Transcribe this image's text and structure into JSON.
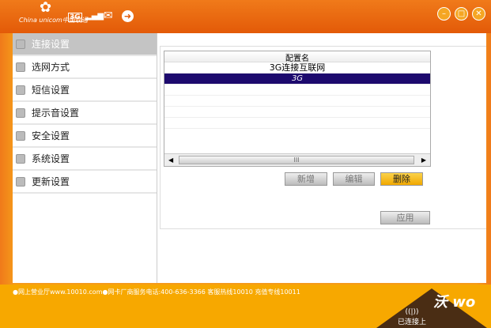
{
  "header": {
    "logo_text": "China unicom中国联通",
    "network_badge": "3G",
    "signal": "signal-bars-icon",
    "icons": [
      "mail-icon",
      "update-icon"
    ],
    "window_controls": [
      "minimize-icon",
      "restore-icon",
      "close-icon"
    ]
  },
  "sidebar": {
    "items": [
      {
        "label": "连接设置",
        "active": true
      },
      {
        "label": "选网方式"
      },
      {
        "label": "短信设置"
      },
      {
        "label": "提示音设置"
      },
      {
        "label": "安全设置"
      },
      {
        "label": "系统设置"
      },
      {
        "label": "更新设置"
      }
    ]
  },
  "table": {
    "header": "配置名",
    "rows": [
      "3G连接互联网",
      "3G"
    ],
    "selected_row": 1,
    "scroll_thumb": "III"
  },
  "buttons": {
    "add": "新增",
    "edit": "编辑",
    "delete": "删除",
    "apply": "应用"
  },
  "footer": {
    "text": "●网上营业厅www.10010.com●网卡厂商服务电话:400-636-3366  客服热线10010  充值专线10011",
    "status": "已连接上",
    "brand": "沃"
  },
  "colors": {
    "header": "#e35a08",
    "footer": "#f7a800",
    "selection": "#1d0a6e"
  }
}
